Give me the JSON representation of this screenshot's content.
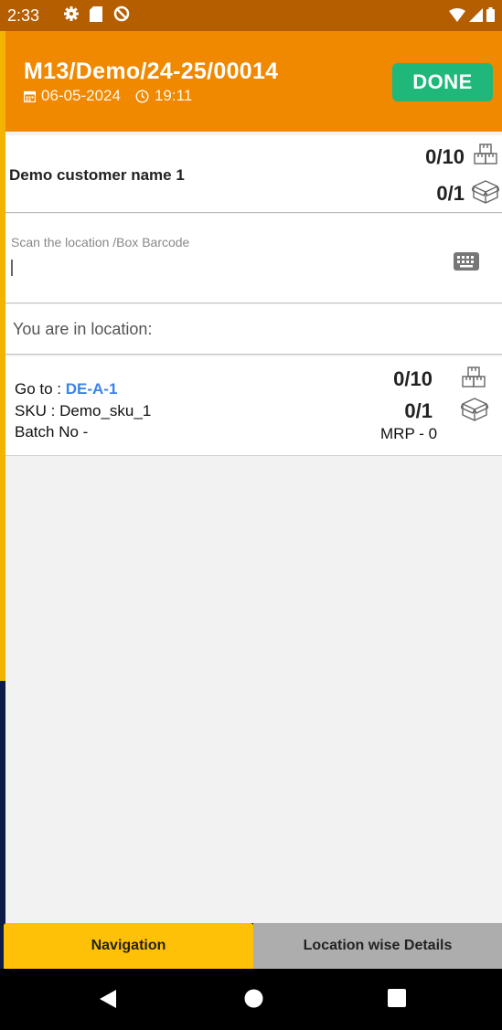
{
  "status_bar": {
    "time": "2:33"
  },
  "header": {
    "document_no": "M13/Demo/24-25/00014",
    "date": "06-05-2024",
    "time": "19:11",
    "done_label": "DONE"
  },
  "customer": {
    "name": "Demo customer name 1",
    "qty_count": "0/10",
    "box_count": "0/1"
  },
  "scan": {
    "placeholder": "Scan the location /Box Barcode"
  },
  "location": {
    "label": "You are in location:"
  },
  "item": {
    "goto_label": "Go to : ",
    "goto_value": "DE-A-1",
    "sku": "SKU : Demo_sku_1",
    "batch": "Batch No -",
    "qty_count": "0/10",
    "box_count": "0/1",
    "mrp": "MRP - 0"
  },
  "tabs": {
    "navigation": "Navigation",
    "location_details": "Location wise Details"
  },
  "colors": {
    "header": "#f08800",
    "done_button": "#1fb87a",
    "active_tab": "#ffc107",
    "link": "#3d83e8"
  }
}
